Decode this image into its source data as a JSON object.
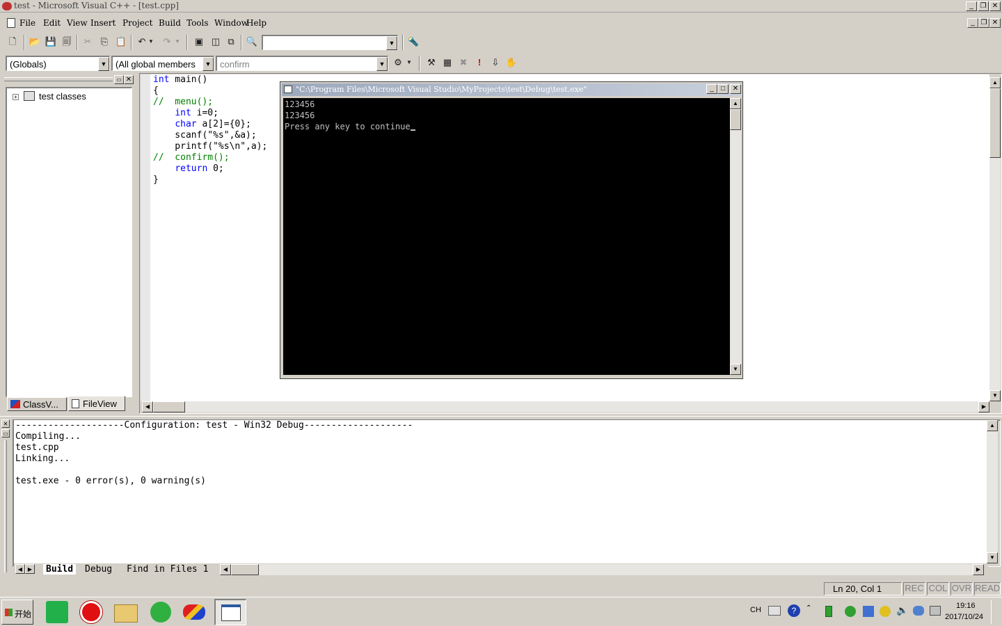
{
  "window": {
    "title": "test - Microsoft Visual C++ - [test.cpp]"
  },
  "menu": [
    {
      "label": "File"
    },
    {
      "label": "Edit"
    },
    {
      "label": "View"
    },
    {
      "label": "Insert"
    },
    {
      "label": "Project"
    },
    {
      "label": "Build"
    },
    {
      "label": "Tools"
    },
    {
      "label": "Window"
    },
    {
      "label": "Help"
    }
  ],
  "wizard": {
    "scope": "(Globals)",
    "members": "(All global members",
    "function": "confirm"
  },
  "workspace": {
    "tree_root": "test classes",
    "tabs": [
      {
        "label": "ClassV..."
      },
      {
        "label": "FileView"
      }
    ]
  },
  "code": [
    "int main()",
    "{",
    "//  menu();",
    "    int i=0;",
    "    char a[2]={0};",
    "    scanf(\"%s\",&a);",
    "    printf(\"%s\\n\",a);",
    "//  confirm();",
    "    return 0;",
    "}"
  ],
  "console": {
    "title": "\"C:\\Program Files\\Microsoft Visual Studio\\MyProjects\\test\\Debug\\test.exe\"",
    "lines": [
      "123456",
      "123456",
      "Press any key to continue"
    ]
  },
  "output": {
    "lines": [
      "--------------------Configuration: test - Win32 Debug--------------------",
      "Compiling...",
      "test.cpp",
      "Linking...",
      "",
      "test.exe - 0 error(s), 0 warning(s)"
    ],
    "tabs": [
      {
        "label": "Build"
      },
      {
        "label": "Debug"
      },
      {
        "label": "Find in Files 1"
      }
    ]
  },
  "status": {
    "position": "Ln 20, Col 1",
    "indicators": [
      "REC",
      "COL",
      "OVR",
      "READ"
    ]
  },
  "taskbar": {
    "start": "开始",
    "lang": "CH",
    "time": "19:16",
    "date": "2017/10/24"
  }
}
